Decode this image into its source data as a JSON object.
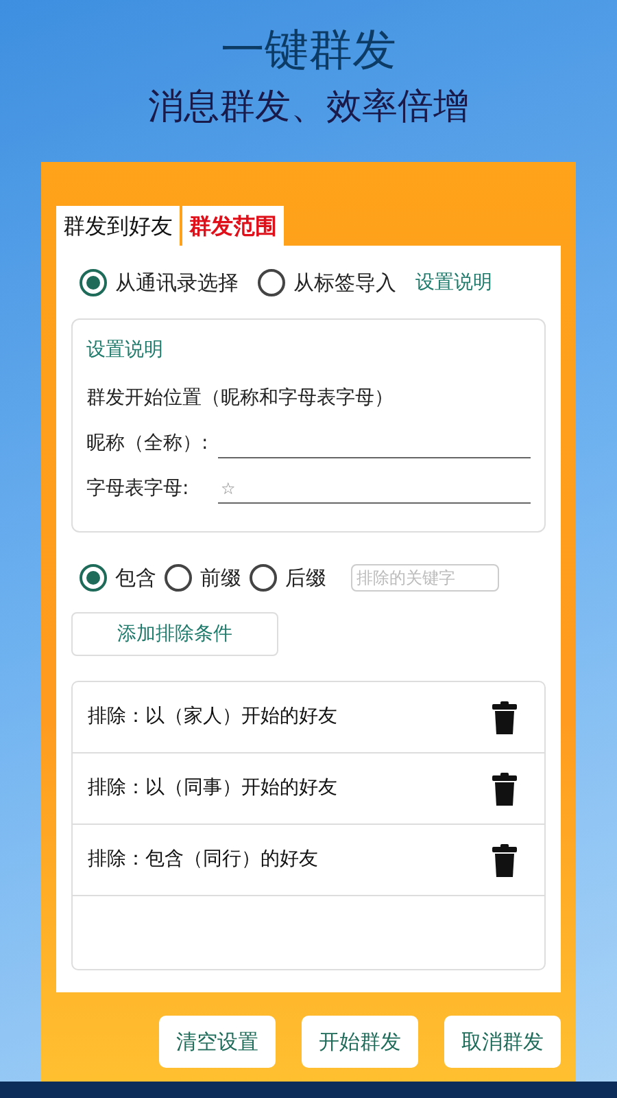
{
  "headline": "一键群发",
  "subheadline": "消息群发、效率倍增",
  "tabs": [
    {
      "label": "群发到好友",
      "selected": false
    },
    {
      "label": "群发范围",
      "selected": true
    }
  ],
  "source_options": [
    {
      "label": "从通讯录选择",
      "selected": true
    },
    {
      "label": "从标签导入",
      "selected": false
    }
  ],
  "help_link": "设置说明",
  "settings_box": {
    "title": "设置说明",
    "description": "群发开始位置（昵称和字母表字母）",
    "fields": [
      {
        "label": "昵称（全称）:"
      },
      {
        "label": "字母表字母:",
        "value": "☆"
      }
    ]
  },
  "match_options": [
    {
      "label": "包含",
      "selected": true
    },
    {
      "label": "前缀",
      "selected": false
    },
    {
      "label": "后缀",
      "selected": false
    }
  ],
  "keyword_field": {
    "placeholder": "排除的关键字"
  },
  "add_button": "添加排除条件",
  "rules": [
    {
      "text": "排除：以（家人）开始的好友"
    },
    {
      "text": "排除：以（同事）开始的好友"
    },
    {
      "text": "排除：包含（同行）的好友"
    }
  ],
  "buttons": [
    "清空设置",
    "开始群发",
    "取消群发"
  ]
}
